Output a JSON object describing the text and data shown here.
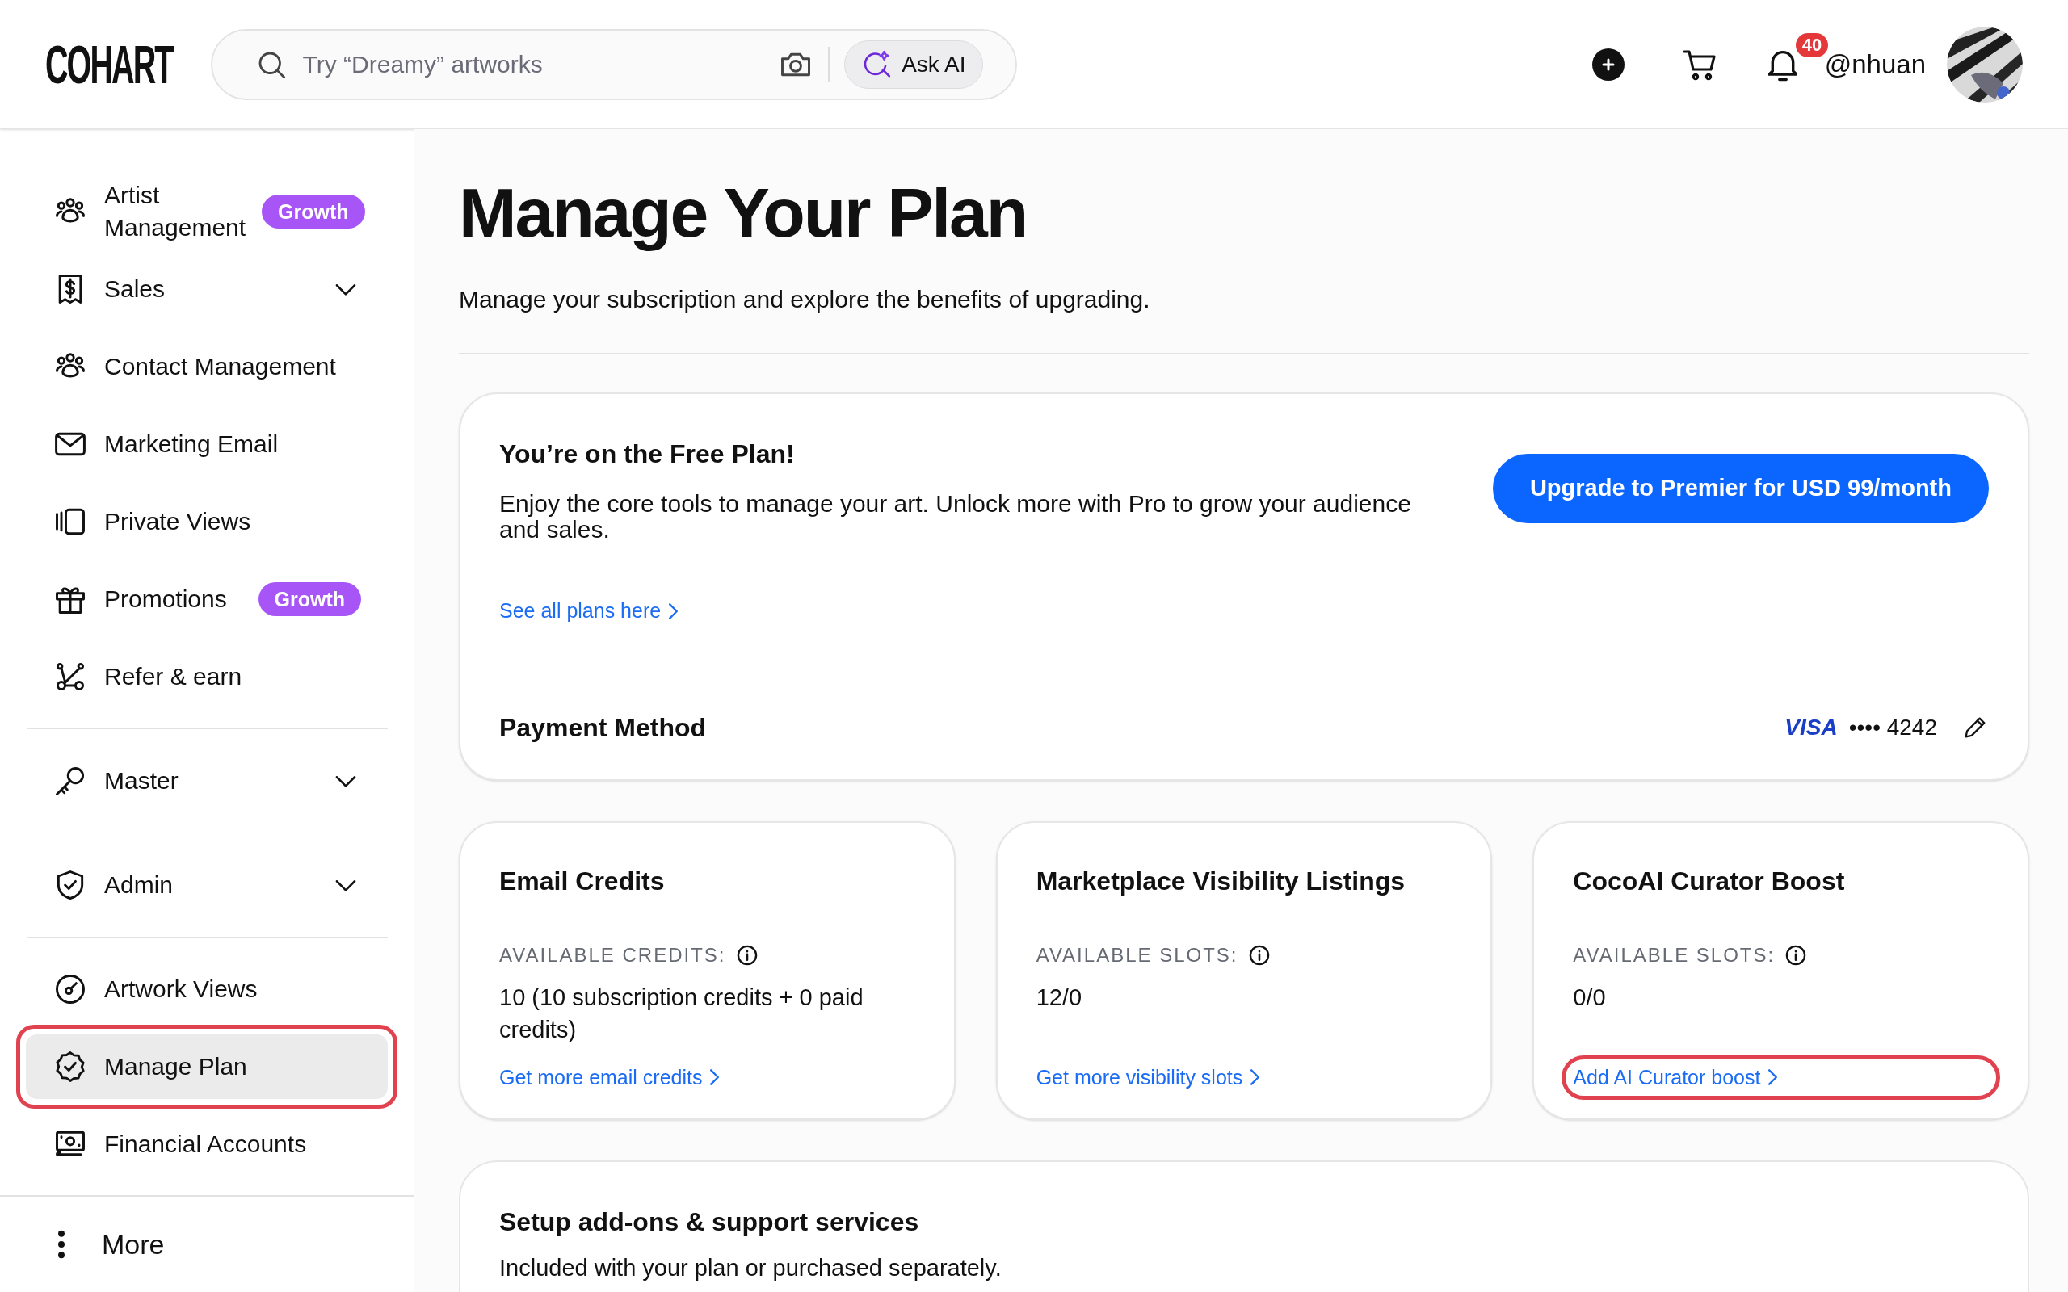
{
  "header": {
    "logo": "COHART",
    "search": {
      "placeholder": "Try “Dreamy” artworks"
    },
    "ask_ai": "Ask AI",
    "notifications": "40",
    "username": "@nhuan"
  },
  "sidebar": {
    "groups": [
      {
        "items": [
          {
            "label": "Artist Management",
            "badge": "Growth",
            "selected": false,
            "annotated": false
          },
          {
            "label": "Sales",
            "expanded": false,
            "selected": false,
            "annotated": false
          },
          {
            "label": "Contact Management",
            "selected": false,
            "annotated": false
          },
          {
            "label": "Marketing Email",
            "selected": false,
            "annotated": false
          },
          {
            "label": "Private Views",
            "selected": false,
            "annotated": false
          },
          {
            "label": "Promotions",
            "badge": "Growth",
            "selected": false,
            "annotated": false
          },
          {
            "label": "Refer & earn",
            "selected": false,
            "annotated": false
          }
        ]
      },
      {
        "items": [
          {
            "label": "Master",
            "expanded": false,
            "selected": false,
            "annotated": false
          }
        ]
      },
      {
        "items": [
          {
            "label": "Admin",
            "expanded": false,
            "selected": false,
            "annotated": false
          }
        ]
      },
      {
        "items": [
          {
            "label": "Artwork Views",
            "selected": false,
            "annotated": false
          },
          {
            "label": "Manage Plan",
            "selected": true,
            "annotated": true
          },
          {
            "label": "Financial Accounts",
            "selected": false,
            "annotated": false
          }
        ]
      }
    ],
    "more": "More"
  },
  "main": {
    "title": "Manage Your Plan",
    "subtitle": "Manage your subscription and explore the benefits of upgrading.",
    "plan_card": {
      "title": "You’re on the Free Plan!",
      "description": "Enjoy the core tools to manage your art. Unlock more with Pro to grow your audience and sales.",
      "upgrade_button": "Upgrade to Premier for USD 99/month",
      "link": "See all plans here",
      "payment_label": "Payment Method",
      "card_brand": "VISA",
      "card_number": "•••• 4242"
    },
    "credit_cards": [
      {
        "title": "Email Credits",
        "label": "AVAILABLE CREDITS:",
        "value": "10 (10 subscription credits + 0 paid credits)",
        "link": "Get more email credits",
        "annotated": false
      },
      {
        "title": "Marketplace Visibility Listings",
        "label": "AVAILABLE SLOTS:",
        "value": "12/0",
        "link": "Get more visibility slots",
        "annotated": false
      },
      {
        "title": "CocoAI Curator Boost",
        "label": "AVAILABLE SLOTS:",
        "value": "0/0",
        "link": "Add AI Curator boost",
        "annotated": true
      }
    ],
    "addons": {
      "title": "Setup add-ons & support services",
      "description": "Included with your plan or purchased separately."
    }
  }
}
